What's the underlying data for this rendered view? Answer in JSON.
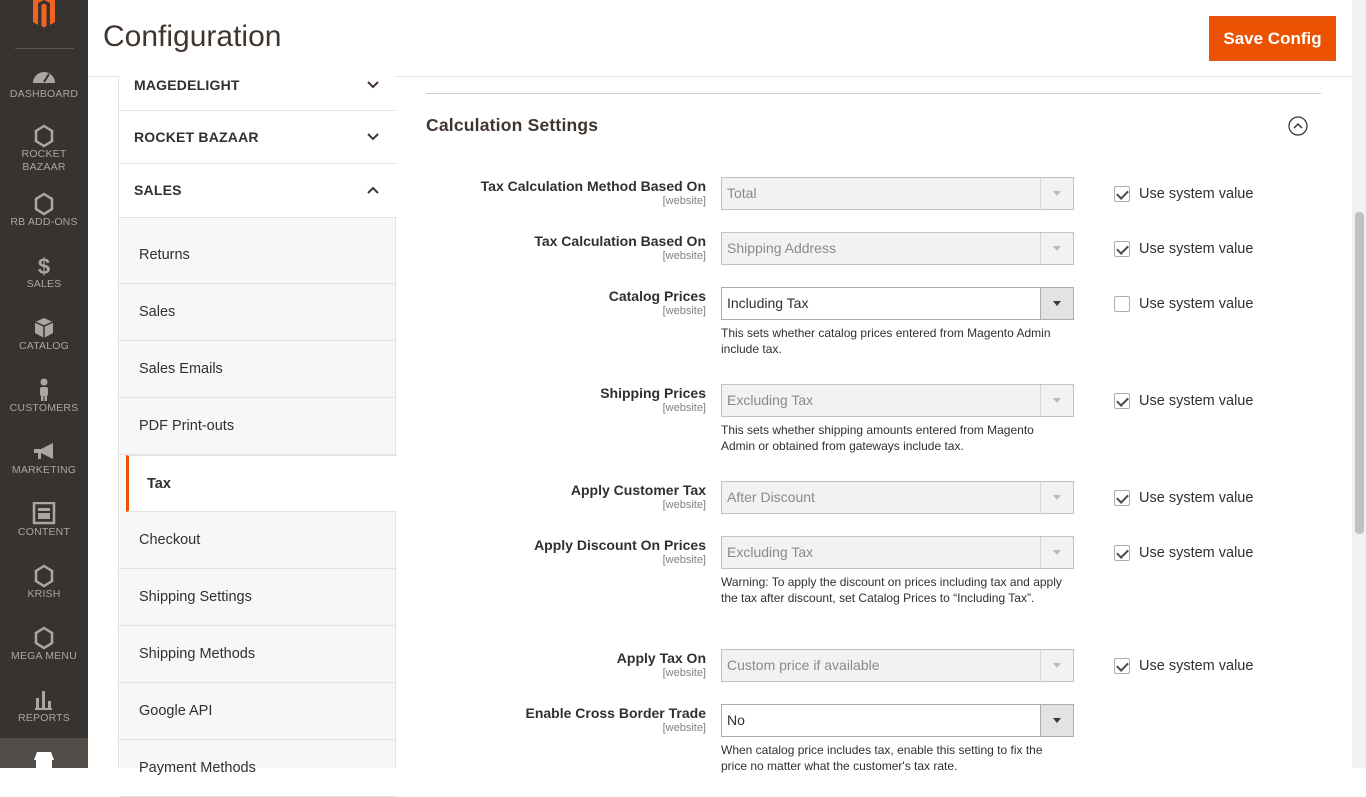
{
  "nav": {
    "items": [
      {
        "label": "DASHBOARD",
        "icon": "speedometer-icon"
      },
      {
        "label": "ROCKET\nBAZAAR",
        "icon": "hexagon-icon"
      },
      {
        "label": "RB ADD-ONS",
        "icon": "hexagon-icon"
      },
      {
        "label": "SALES",
        "icon": "dollar-icon"
      },
      {
        "label": "CATALOG",
        "icon": "cube-icon"
      },
      {
        "label": "CUSTOMERS",
        "icon": "person-icon"
      },
      {
        "label": "MARKETING",
        "icon": "megaphone-icon"
      },
      {
        "label": "CONTENT",
        "icon": "layout-icon"
      },
      {
        "label": "KRISH",
        "icon": "hexagon-icon"
      },
      {
        "label": "MEGA MENU",
        "icon": "hexagon-icon"
      },
      {
        "label": "REPORTS",
        "icon": "bar-chart-icon"
      }
    ]
  },
  "header": {
    "title": "Configuration",
    "save_label": "Save Config"
  },
  "tabs": {
    "groups": [
      {
        "label": "MAGEDELIGHT"
      },
      {
        "label": "ROCKET BAZAAR"
      },
      {
        "label": "SALES"
      }
    ],
    "sales_items": [
      {
        "label": "Returns"
      },
      {
        "label": "Sales"
      },
      {
        "label": "Sales Emails"
      },
      {
        "label": "PDF Print-outs"
      },
      {
        "label": "Tax"
      },
      {
        "label": "Checkout"
      },
      {
        "label": "Shipping Settings"
      },
      {
        "label": "Shipping Methods"
      },
      {
        "label": "Google API"
      },
      {
        "label": "Payment Methods"
      }
    ]
  },
  "section": {
    "title": "Calculation Settings",
    "system_label": "Use system value",
    "fields": [
      {
        "label": "Tax Calculation Method Based On",
        "scope": "[website]",
        "value": "Total",
        "use_system": true
      },
      {
        "label": "Tax Calculation Based On",
        "scope": "[website]",
        "value": "Shipping Address",
        "use_system": true
      },
      {
        "label": "Catalog Prices",
        "scope": "[website]",
        "value": "Including Tax",
        "use_system": false,
        "note": "This sets whether catalog prices entered from Magento Admin include tax."
      },
      {
        "label": "Shipping Prices",
        "scope": "[website]",
        "value": "Excluding Tax",
        "use_system": true,
        "note": "This sets whether shipping amounts entered from Magento Admin or obtained from gateways include tax."
      },
      {
        "label": "Apply Customer Tax",
        "scope": "[website]",
        "value": "After Discount",
        "use_system": true
      },
      {
        "label": "Apply Discount On Prices",
        "scope": "[website]",
        "value": "Excluding Tax",
        "use_system": true,
        "note": "Warning: To apply the discount on prices including tax and apply the tax after discount, set Catalog Prices to “Including Tax”."
      },
      {
        "label": "Apply Tax On",
        "scope": "[website]",
        "value": "Custom price if available",
        "use_system": true
      },
      {
        "label": "Enable Cross Border Trade",
        "scope": "[website]",
        "value": "No",
        "note": "When catalog price includes tax, enable this setting to fix the price no matter what the customer's tax rate."
      }
    ]
  },
  "colors": {
    "accent": "#eb5202",
    "nav_bg": "#373330"
  }
}
